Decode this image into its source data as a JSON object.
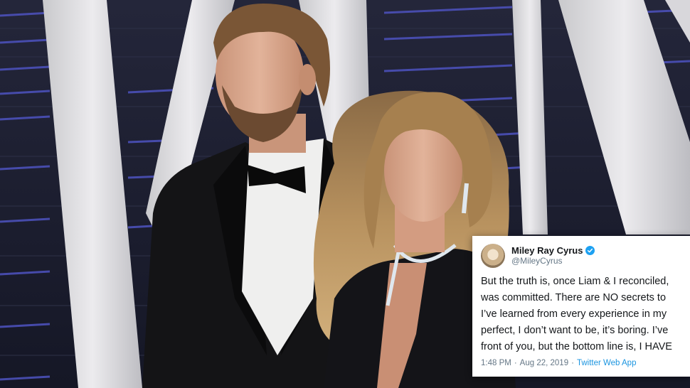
{
  "tweet": {
    "display_name": "Miley Ray Cyrus",
    "handle": "@MileyCyrus",
    "verified_icon": "verified-badge-icon",
    "lines": [
      "But the truth is, once Liam & I reconciled,",
      "was committed. There are NO secrets to",
      "I’ve learned from every experience in my",
      "perfect, I don’t want to be, it’s boring. I’ve",
      "front of you, but the bottom line is, I HAVE"
    ],
    "time": "1:48 PM",
    "date": "Aug 22, 2019",
    "separator": "·",
    "source": "Twitter Web App"
  },
  "colors": {
    "backdrop": "#1b1d2e",
    "backdrop_light": "#5560c8",
    "card": "#ffffff",
    "twitter_blue": "#1da1f2",
    "muted_text": "#657786"
  }
}
